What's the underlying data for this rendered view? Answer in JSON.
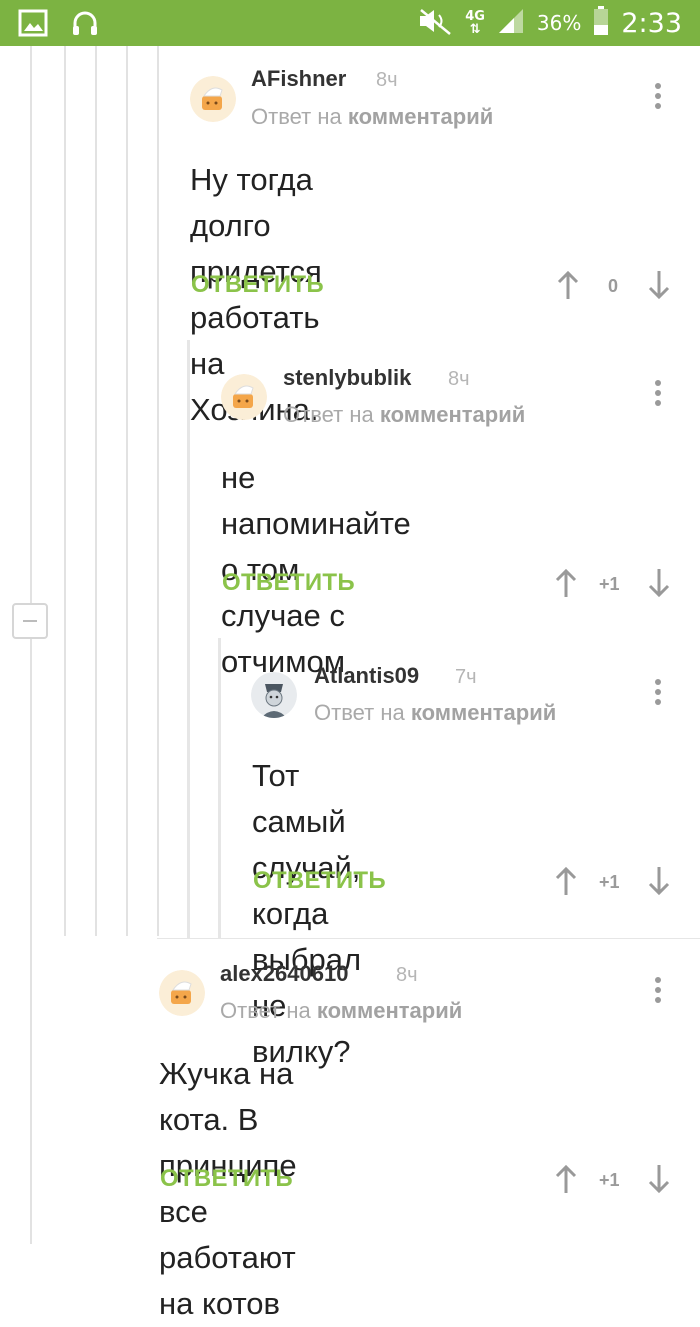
{
  "statusbar": {
    "network": "4G",
    "battery": "36%",
    "time": "2:33"
  },
  "reply_to_prefix": "Ответ на",
  "reply_to_target": "комментарий",
  "comments": [
    {
      "user": "AFishner",
      "time": "8ч",
      "text1": "Ну тогда долго придется",
      "text2": "работать на Хозяина.",
      "reply": "ОТВЕТИТЬ",
      "score": "0"
    },
    {
      "user": "stenlybublik",
      "time": "8ч",
      "text1": "не напоминайте о том",
      "text2": "случае с отчимом",
      "reply": "ОТВЕТИТЬ",
      "score": "+1"
    },
    {
      "user": "Atlantis09",
      "time": "7ч",
      "text1": "Тот самый случай, когда",
      "text2": "выбрал не вилку?",
      "reply": "ОТВЕТИТЬ",
      "score": "+1"
    },
    {
      "user": "alex2640610",
      "time": "8ч",
      "text1": "Жучка на кота. В принципе все",
      "text2": "работают на котов",
      "reply": "ОТВЕТИТЬ",
      "score": "+1"
    }
  ]
}
